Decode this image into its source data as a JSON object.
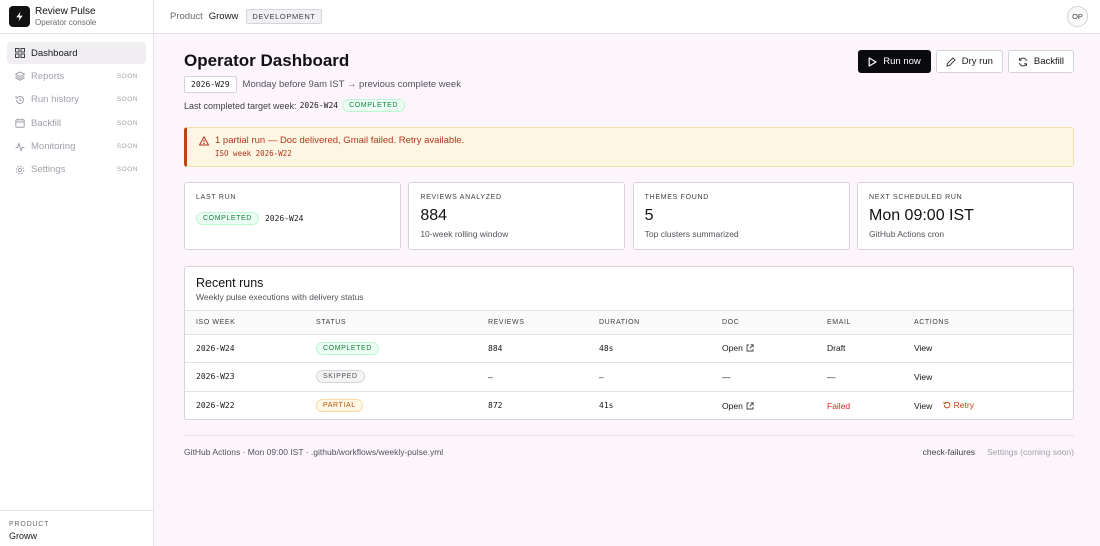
{
  "brand": {
    "name": "Review Pulse",
    "subtitle": "Operator console"
  },
  "sidebar": {
    "items": [
      {
        "label": "Dashboard",
        "icon": "grid-icon",
        "soon": ""
      },
      {
        "label": "Reports",
        "icon": "layers-icon",
        "soon": "SOON"
      },
      {
        "label": "Run history",
        "icon": "history-icon",
        "soon": "SOON"
      },
      {
        "label": "Backfill",
        "icon": "calendar-icon",
        "soon": "SOON"
      },
      {
        "label": "Monitoring",
        "icon": "activity-icon",
        "soon": "SOON"
      },
      {
        "label": "Settings",
        "icon": "gear-icon",
        "soon": "SOON"
      }
    ],
    "footer": {
      "key": "PRODUCT",
      "value": "Groww"
    }
  },
  "topbar": {
    "crumb_label": "Product",
    "crumb_value": "Groww",
    "env_badge": "DEVELOPMENT",
    "avatar": "OP"
  },
  "header": {
    "title": "Operator Dashboard",
    "week_chip": "2026-W29",
    "week_desc": "Monday before 9am IST → previous complete week",
    "last_label": "Last completed target week:",
    "last_week": "2026-W24",
    "last_status": "COMPLETED"
  },
  "actions": {
    "run_now": "Run now",
    "dry_run": "Dry run",
    "backfill": "Backfill"
  },
  "alert": {
    "title": "1 partial run — Doc delivered, Gmail failed. Retry available.",
    "sub": "ISO week 2026-W22"
  },
  "stats": {
    "last_run": {
      "label": "LAST RUN",
      "status": "COMPLETED",
      "week": "2026-W24"
    },
    "reviews": {
      "label": "REVIEWS ANALYZED",
      "value": "884",
      "sub": "10-week rolling window"
    },
    "themes": {
      "label": "THEMES FOUND",
      "value": "5",
      "sub": "Top clusters summarized"
    },
    "next": {
      "label": "NEXT SCHEDULED RUN",
      "value": "Mon 09:00 IST",
      "sub": "GitHub Actions cron"
    }
  },
  "runs": {
    "title": "Recent runs",
    "subtitle": "Weekly pulse executions with delivery status",
    "columns": [
      "ISO WEEK",
      "STATUS",
      "REVIEWS",
      "DURATION",
      "DOC",
      "EMAIL",
      "ACTIONS"
    ],
    "rows": [
      {
        "week": "2026-W24",
        "status": "COMPLETED",
        "reviews": "884",
        "duration": "48s",
        "doc": "Open",
        "email": "Draft",
        "action": "View",
        "retry": ""
      },
      {
        "week": "2026-W23",
        "status": "SKIPPED",
        "reviews": "–",
        "duration": "–",
        "doc": "—",
        "email": "—",
        "action": "View",
        "retry": ""
      },
      {
        "week": "2026-W22",
        "status": "PARTIAL",
        "reviews": "872",
        "duration": "41s",
        "doc": "Open",
        "email": "Failed",
        "action": "View",
        "retry": "Retry"
      }
    ]
  },
  "footer": {
    "info": "GitHub Actions · Mon 09:00 IST · .github/workflows/weekly-pulse.yml",
    "link": "check-failures",
    "soon": "Settings (coming soon)"
  },
  "colors": {
    "accent": "#0b0b0f",
    "success": "#15803d",
    "warning": "#b45309",
    "danger": "#dc2626",
    "background": "#fcf5fc"
  }
}
